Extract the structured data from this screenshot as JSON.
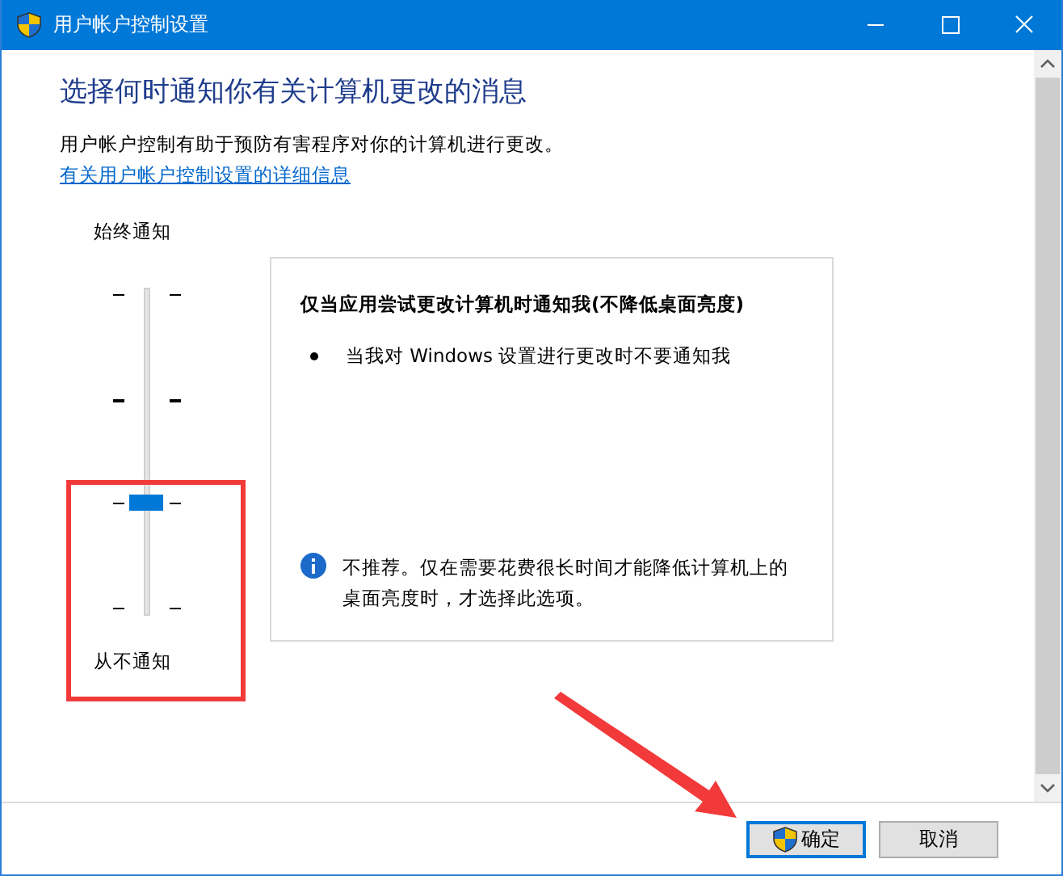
{
  "window": {
    "title": "用户帐户控制设置"
  },
  "heading": "选择何时通知你有关计算机更改的消息",
  "description": "用户帐户控制有助于预防有害程序对你的计算机进行更改。",
  "link": "有关用户帐户控制设置的详细信息",
  "slider": {
    "top_label": "始终通知",
    "bottom_label": "从不通知",
    "level": 0.3333
  },
  "info_panel": {
    "title": "仅当应用尝试更改计算机时通知我(不降低桌面亮度)",
    "bullets": [
      "当我对 Windows 设置进行更改时不要通知我"
    ],
    "note": "不推荐。仅在需要花费很长时间才能降低计算机上的桌面亮度时，才选择此选项。"
  },
  "buttons": [
    {
      "label": "确定",
      "kind": "shield",
      "default": true
    },
    {
      "label": "取消",
      "kind": "plain",
      "default": false
    }
  ],
  "annotations": {
    "highlight_box": true,
    "arrow": true
  }
}
